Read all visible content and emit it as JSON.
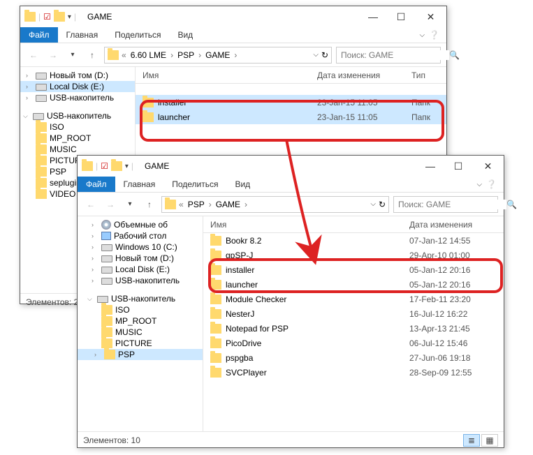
{
  "win1": {
    "title": "GAME",
    "tabs": {
      "file": "Файл",
      "home": "Главная",
      "share": "Поделиться",
      "view": "Вид"
    },
    "breadcrumb": {
      "p1": "6.60 LME",
      "p2": "PSP",
      "p3": "GAME"
    },
    "search_placeholder": "Поиск: GAME",
    "headers": {
      "name": "Имя",
      "date": "Дата изменения",
      "type": "Тип"
    },
    "tree": {
      "newtom": "Новый том (D:)",
      "local": "Local Disk (E:)",
      "usb1": "USB-накопитель",
      "usb2": "USB-накопитель",
      "iso": "ISO",
      "mproot": "MP_ROOT",
      "music": "MUSIC",
      "picture": "PICTURE",
      "psp": "PSP",
      "seplugins": "seplugins",
      "video": "VIDEO"
    },
    "rows": [
      {
        "name": "installer",
        "date": "23-Jan-15 11:05",
        "type": "Папк"
      },
      {
        "name": "launcher",
        "date": "23-Jan-15 11:05",
        "type": "Папк"
      }
    ],
    "status_label": "Элементов:",
    "status_count": "2"
  },
  "win2": {
    "title": "GAME",
    "tabs": {
      "file": "Файл",
      "home": "Главная",
      "share": "Поделиться",
      "view": "Вид"
    },
    "breadcrumb": {
      "p1": "PSP",
      "p2": "GAME"
    },
    "search_placeholder": "Поиск: GAME",
    "headers": {
      "name": "Имя",
      "date": "Дата изменения"
    },
    "tree": {
      "volumes": "Объемные об",
      "desktop": "Рабочий стол",
      "win10": "Windows 10 (C:)",
      "newtom": "Новый том (D:)",
      "local": "Local Disk (E:)",
      "usb1": "USB-накопитель",
      "usb2": "USB-накопитель",
      "iso": "ISO",
      "mproot": "MP_ROOT",
      "music": "MUSIC",
      "picture": "PICTURE",
      "psp": "PSP"
    },
    "rows": [
      {
        "name": "Bookr 8.2",
        "date": "07-Jan-12 14:55"
      },
      {
        "name": "gpSP-J",
        "date": "29-Apr-10 01:00"
      },
      {
        "name": "installer",
        "date": "05-Jan-12 20:16"
      },
      {
        "name": "launcher",
        "date": "05-Jan-12 20:16"
      },
      {
        "name": "Module Checker",
        "date": "17-Feb-11 23:20"
      },
      {
        "name": "NesterJ",
        "date": "16-Jul-12 16:22"
      },
      {
        "name": "Notepad for PSP",
        "date": "13-Apr-13 21:45"
      },
      {
        "name": "PicoDrive",
        "date": "06-Jul-12 15:46"
      },
      {
        "name": "pspgba",
        "date": "27-Jun-06 19:18"
      },
      {
        "name": "SVCPlayer",
        "date": "28-Sep-09 12:55"
      }
    ],
    "status_label": "Элементов:",
    "status_count": "10"
  }
}
